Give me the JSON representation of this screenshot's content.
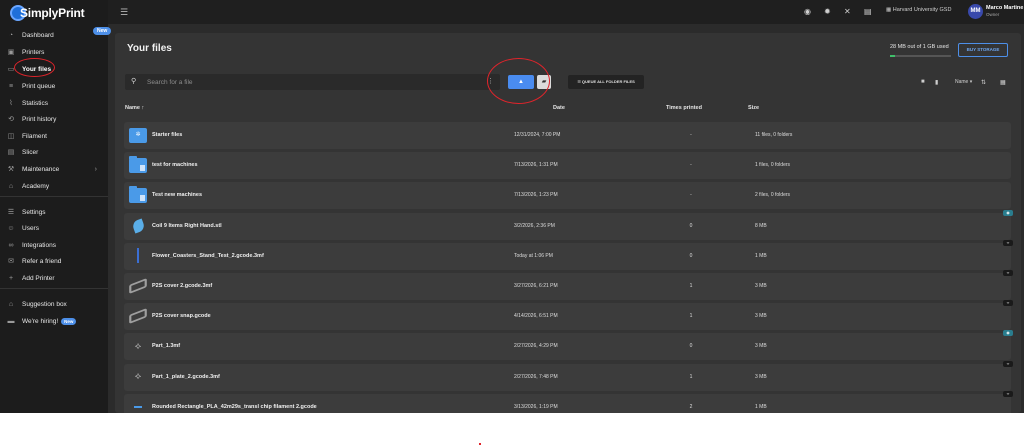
{
  "app": {
    "name": "SimplyPrint"
  },
  "sidebar": {
    "new_badge": "New",
    "items": [
      {
        "label": "Dashboard",
        "icon": "gauge-icon"
      },
      {
        "label": "Printers",
        "icon": "printer-icon"
      },
      {
        "label": "Your files",
        "icon": "folder-icon",
        "active": true
      },
      {
        "label": "Print queue",
        "icon": "list-icon"
      },
      {
        "label": "Statistics",
        "icon": "chart-icon"
      },
      {
        "label": "Print history",
        "icon": "history-icon"
      },
      {
        "label": "Filament",
        "icon": "spool-icon"
      },
      {
        "label": "Slicer",
        "icon": "slicer-icon"
      },
      {
        "label": "Maintenance",
        "icon": "wrench-icon"
      },
      {
        "label": "Academy",
        "icon": "graduation-cap-icon"
      },
      {
        "label": "Settings",
        "icon": "sliders-icon"
      },
      {
        "label": "Users",
        "icon": "users-icon"
      },
      {
        "label": "Integrations",
        "icon": "link-icon"
      },
      {
        "label": "Refer a friend",
        "icon": "gift-icon"
      },
      {
        "label": "Add Printer",
        "icon": "plus-icon"
      },
      {
        "label": "Suggestion box",
        "icon": "inbox-icon"
      },
      {
        "label": "We're hiring!",
        "icon": "briefcase-icon",
        "badge": "New"
      }
    ]
  },
  "topbar": {
    "organization": "Harvard University GSD",
    "user_initials": "MM",
    "user_name": "Marco Martine",
    "user_role": "Owner"
  },
  "page": {
    "title": "Your files",
    "storage_text": "28 MB out of 1 GB used",
    "storage_used_fraction": 0.028,
    "buy_storage": "BUY STORAGE",
    "search_placeholder": "Search for a file",
    "queue_all_label": "QUEUE ALL FOLDER FILES",
    "sort_label": "Name"
  },
  "table": {
    "headers": {
      "name": "Name",
      "date": "Date",
      "printed": "Times printed",
      "size": "Size"
    },
    "rows": [
      {
        "name": "Starter files",
        "date": "12/31/2024, 7:00 PM",
        "printed": "-",
        "size": "11 files, 0 folders",
        "thumb": "starter"
      },
      {
        "name": "test for machines",
        "date": "7/13/2026, 1:31 PM",
        "printed": "-",
        "size": "1 files, 0 folders",
        "thumb": "folder"
      },
      {
        "name": "Test new machines",
        "date": "7/13/2026, 1:23 PM",
        "printed": "-",
        "size": "2 files, 0 folders",
        "thumb": "folder"
      },
      {
        "name": "Coil 9 Items Right Hand.stl",
        "date": "3/2/2026, 2:36 PM",
        "printed": "0",
        "size": "8 MB",
        "thumb": "leaf",
        "tag": "teal"
      },
      {
        "name": "Flower_Coasters_Stand_Test_2.gcode.3mf",
        "date": "Today at 1:06 PM",
        "printed": "0",
        "size": "1 MB",
        "thumb": "line",
        "tag": "code"
      },
      {
        "name": "P2S cover 2.gcode.3mf",
        "date": "3/27/2026, 6:21 PM",
        "printed": "1",
        "size": "3 MB",
        "thumb": "plate",
        "tag": "code"
      },
      {
        "name": "P2S cover snap.gcode",
        "date": "4/14/2026, 6:51 PM",
        "printed": "1",
        "size": "3 MB",
        "thumb": "plate",
        "tag": "code"
      },
      {
        "name": "Part_1.3mf",
        "date": "2/27/2026, 4:29 PM",
        "printed": "0",
        "size": "3 MB",
        "thumb": "arm",
        "tag": "teal"
      },
      {
        "name": "Part_1_plate_2.gcode.3mf",
        "date": "2/27/2026, 7:48 PM",
        "printed": "1",
        "size": "3 MB",
        "thumb": "arm",
        "tag": "code"
      },
      {
        "name": "Rounded Rectangle_PLA_42m29s_transl chip filament 2.gcode",
        "date": "3/13/2026, 1:19 PM",
        "printed": "2",
        "size": "1 MB",
        "thumb": "dash",
        "tag": "code"
      }
    ]
  }
}
